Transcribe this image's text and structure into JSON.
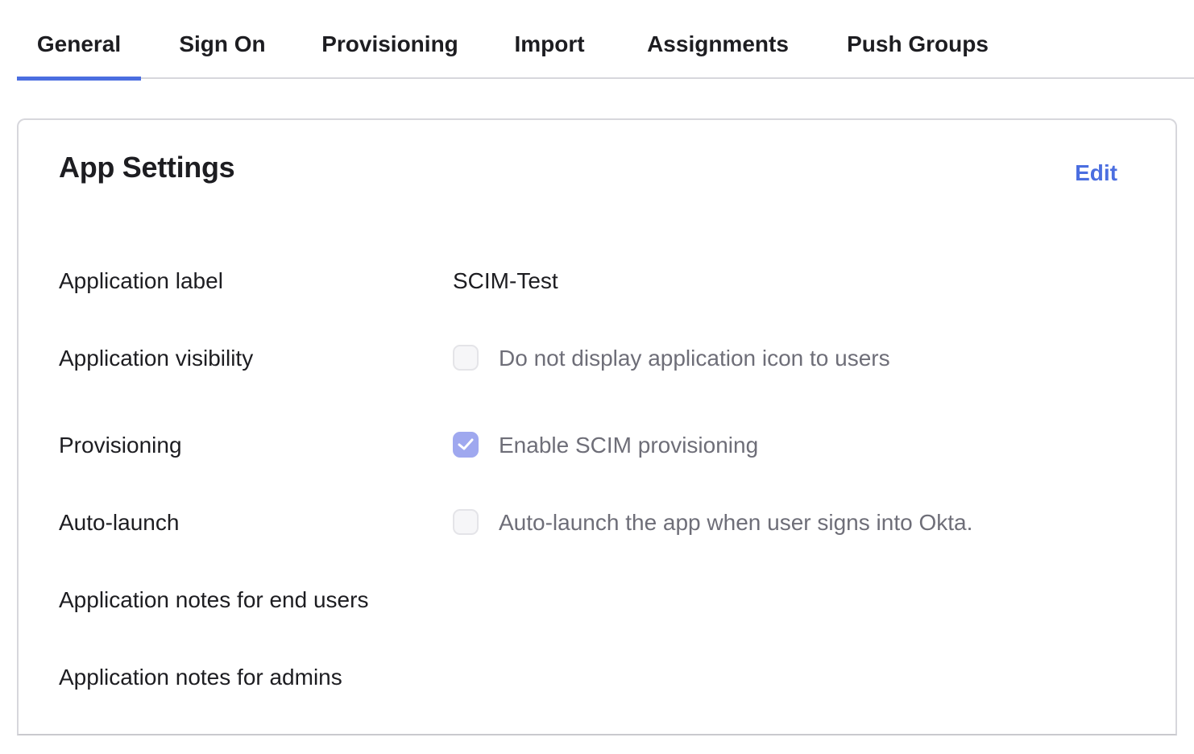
{
  "tabs": [
    {
      "label": "General",
      "active": true
    },
    {
      "label": "Sign On",
      "active": false
    },
    {
      "label": "Provisioning",
      "active": false
    },
    {
      "label": "Import",
      "active": false
    },
    {
      "label": "Assignments",
      "active": false
    },
    {
      "label": "Push Groups",
      "active": false
    }
  ],
  "panel": {
    "title": "App Settings",
    "edit_label": "Edit",
    "rows": [
      {
        "label": "Application label",
        "value": "SCIM-Test"
      },
      {
        "label": "Application visibility",
        "checkbox_label": "Do not display application icon to users",
        "checked": false
      },
      {
        "label": "Provisioning",
        "checkbox_label": "Enable SCIM provisioning",
        "checked": true
      },
      {
        "label": "Auto-launch",
        "checkbox_label": "Auto-launch the app when user signs into Okta.",
        "checked": false
      },
      {
        "label": "Application notes for end users"
      },
      {
        "label": "Application notes for admins"
      }
    ]
  },
  "colors": {
    "accent": "#4b6ee0",
    "checkbox_checked": "#9fa8ef",
    "border": "#d7d7dc",
    "muted_text": "#6e6e78"
  }
}
